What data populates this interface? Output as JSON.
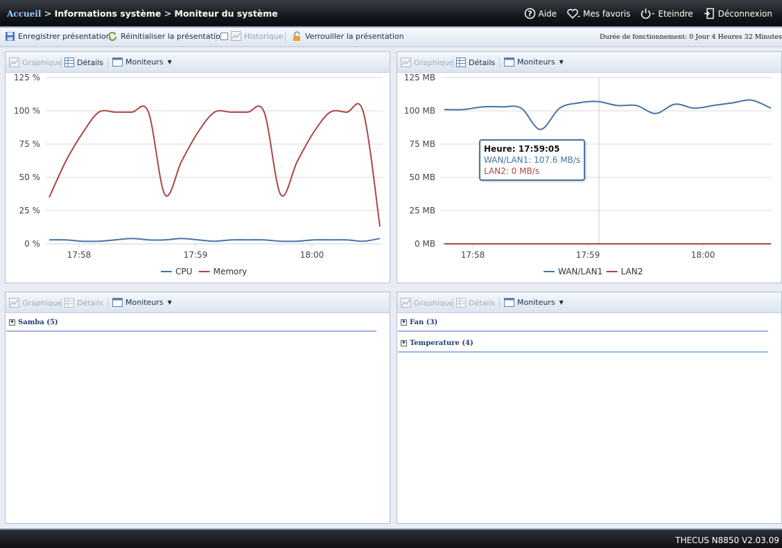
{
  "breadcrumb": {
    "home": "Accueil",
    "sep": ">",
    "level1": "Informations système",
    "level2": "Moniteur du système"
  },
  "top_links": {
    "help": "Aide",
    "favorites": "Mes favoris",
    "shutdown": "Eteindre",
    "logout": "Déconnexion"
  },
  "toolbar": {
    "save": "Enregistrer présentation",
    "reset": "Réinitialiser la présentation",
    "history": "Historique",
    "lock": "Verrouiller la présentation",
    "uptime": "Durée de fonctionnement:  0 Jour 4 Heures 32 Minutes"
  },
  "panel_labels": {
    "graph": "Graphique",
    "details": "Détails",
    "monitors": "Moniteurs"
  },
  "panels": {
    "bottom_left": {
      "groups": [
        "Samba (5)"
      ]
    },
    "bottom_right": {
      "groups": [
        "Fan (3)",
        "Temperature (4)"
      ]
    }
  },
  "tooltip": {
    "time": "Heure: 17:59:05",
    "wan": "WAN/LAN1: 107.6 MB/s",
    "lan2": "LAN2: 0 MB/s"
  },
  "footer": {
    "version": "THECUS N8850 V2.03.09"
  },
  "colors": {
    "blue": "#4572a7",
    "red": "#aa4643"
  },
  "chart_data": [
    {
      "type": "line",
      "x_ticks": [
        "17:58",
        "17:59",
        "18:00"
      ],
      "y_ticks": [
        "0 %",
        "25 %",
        "50 %",
        "75 %",
        "100 %",
        "125 %"
      ],
      "ylim": [
        0,
        125
      ],
      "grid": true,
      "legend": "bottom-center",
      "series": [
        {
          "name": "CPU",
          "color": "#4572a7",
          "values": [
            3,
            3,
            2,
            2,
            3,
            4,
            3,
            3,
            4,
            3,
            2,
            3,
            3,
            3,
            2,
            2,
            3,
            3,
            3,
            2,
            4
          ]
        },
        {
          "name": "Memory",
          "color": "#aa4643",
          "values": [
            35,
            62,
            83,
            99,
            99,
            99,
            99,
            37,
            62,
            84,
            99,
            99,
            99,
            99,
            37,
            62,
            84,
            99,
            99,
            99,
            13
          ]
        }
      ]
    },
    {
      "type": "line",
      "x_ticks": [
        "17:58",
        "17:59",
        "18:00"
      ],
      "y_ticks": [
        "0 MB",
        "25 MB",
        "50 MB",
        "75 MB",
        "100 MB",
        "125 MB"
      ],
      "ylim": [
        0,
        125
      ],
      "grid": true,
      "legend": "bottom-center",
      "series": [
        {
          "name": "WAN/LAN1",
          "color": "#4572a7",
          "values": [
            101,
            101,
            103,
            103,
            102,
            86,
            102,
            106,
            107,
            104,
            104,
            98,
            105,
            102,
            104,
            106,
            108,
            102
          ]
        },
        {
          "name": "LAN2",
          "color": "#aa4643",
          "values": [
            0,
            0,
            0,
            0,
            0,
            0,
            0,
            0,
            0,
            0,
            0,
            0,
            0,
            0,
            0,
            0,
            0,
            0
          ]
        }
      ]
    }
  ]
}
